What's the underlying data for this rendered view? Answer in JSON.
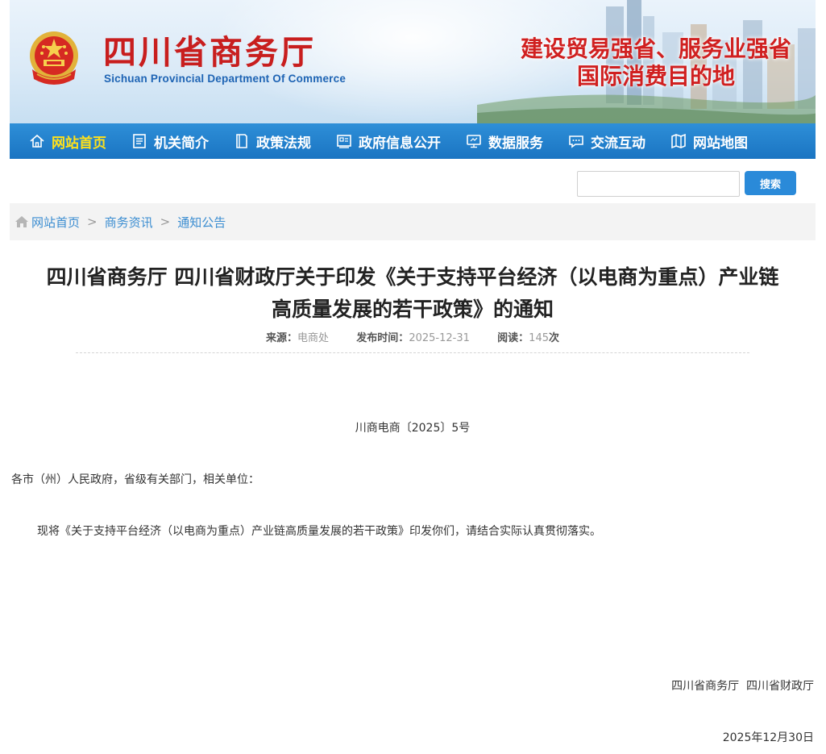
{
  "header": {
    "title": "四川省商务厅",
    "subtitle": "Sichuan Provincial Department Of Commerce",
    "slogan_line1": "建设贸易强省、服务业强省",
    "slogan_line2": "国际消费目的地"
  },
  "nav": {
    "items": [
      {
        "label": "网站首页",
        "icon": "home-icon",
        "active": true
      },
      {
        "label": "机关简介",
        "icon": "document-list-icon"
      },
      {
        "label": "政策法规",
        "icon": "book-icon"
      },
      {
        "label": "政府信息公开",
        "icon": "info-panel-icon"
      },
      {
        "label": "数据服务",
        "icon": "monitor-icon"
      },
      {
        "label": "交流互动",
        "icon": "chat-icon"
      },
      {
        "label": "网站地图",
        "icon": "map-icon"
      }
    ]
  },
  "search": {
    "placeholder": "",
    "button_label": "搜索"
  },
  "breadcrumb": {
    "items": [
      "网站首页",
      "商务资讯",
      "通知公告"
    ],
    "separator": ">"
  },
  "article": {
    "title_line1": "四川省商务厅 四川省财政厅关于印发《关于支持平台经济（以电商为重点）产业链",
    "title_line2": "高质量发展的若干政策》的通知",
    "meta": {
      "source_label": "来源：",
      "source_value": "电商处",
      "date_label": "发布时间：",
      "date_value": "2025-12-31",
      "views_label": "阅读：",
      "views_value": "145",
      "views_unit": "次"
    },
    "doc_number": "川商电商〔2025〕5号",
    "addressee": "各市（州）人民政府，省级有关部门，相关单位：",
    "body": "现将《关于支持平台经济（以电商为重点）产业链高质量发展的若干政策》印发你们，请结合实际认真贯彻落实。",
    "signature": "四川省商务厅  四川省财政厅",
    "signature_date": "2025年12月30日"
  },
  "colors": {
    "nav_bg": "#1a74c2",
    "nav_active": "#ffe11a",
    "title_red": "#c81e1e",
    "link_blue": "#3b8dd1",
    "search_button": "#2a8ad9"
  }
}
